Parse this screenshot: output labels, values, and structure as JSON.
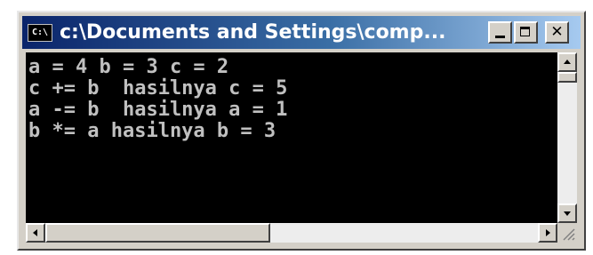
{
  "window": {
    "title": "c:\\Documents and Settings\\comp...",
    "app_icon_label": "C:\\",
    "buttons": {
      "minimize": "minimize-icon",
      "maximize": "maximize-icon",
      "close_glyph": "✕"
    }
  },
  "console": {
    "lines": [
      "a = 4 b = 3 c = 2",
      "c += b  hasilnya c = 5",
      "a -= b  hasilnya a = 1",
      "b *= a hasilnya b = 3"
    ]
  },
  "colors": {
    "console_background": "#000000",
    "console_text": "#c0c0c0",
    "titlebar_start": "#0a246a",
    "titlebar_end": "#a6caf0",
    "chrome": "#d4d0c8"
  }
}
